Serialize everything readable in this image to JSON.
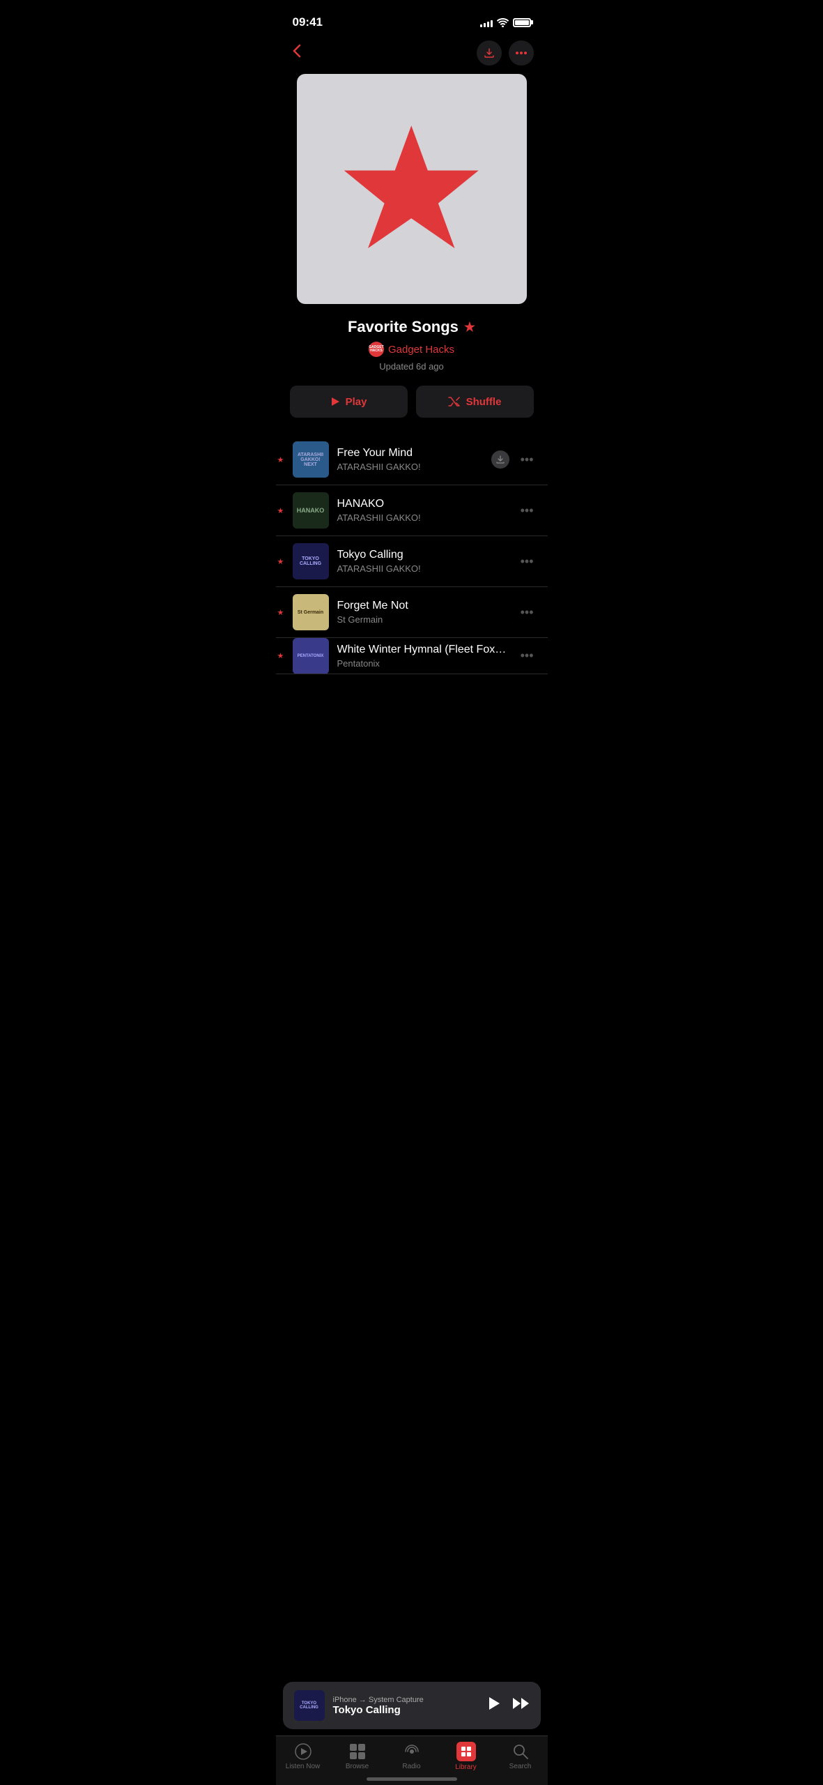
{
  "status": {
    "time": "09:41",
    "signal_bars": [
      4,
      6,
      8,
      10,
      12
    ],
    "battery_level": "100%"
  },
  "nav": {
    "back_label": "‹",
    "download_icon": "download",
    "more_icon": "more"
  },
  "playlist": {
    "title": "Favorite Songs",
    "title_star": "★",
    "author_badge": "GADGET HACKS",
    "author_name": "Gadget Hacks",
    "updated": "Updated 6d ago"
  },
  "buttons": {
    "play": "Play",
    "shuffle": "Shuffle"
  },
  "songs": [
    {
      "title": "Free Your Mind",
      "artist": "ATARASHII GAKKO!",
      "has_star": true,
      "has_download": true,
      "thumb_class": "thumb-1",
      "thumb_text": "ATARASHII GAKKO! NEXT"
    },
    {
      "title": "HANAKO",
      "artist": "ATARASHII GAKKO!",
      "has_star": true,
      "has_download": false,
      "thumb_class": "thumb-2",
      "thumb_text": "HANAKO"
    },
    {
      "title": "Tokyo Calling",
      "artist": "ATARASHII GAKKO!",
      "has_star": true,
      "has_download": false,
      "thumb_class": "thumb-3",
      "thumb_text": "TOKYO CALLING"
    },
    {
      "title": "Forget Me Not",
      "artist": "St Germain",
      "has_star": true,
      "has_download": false,
      "thumb_class": "thumb-4",
      "thumb_text": "St Germain"
    },
    {
      "title": "White Winter Hymnal (Fleet Foxes Cover)",
      "artist": "Pentatonix",
      "has_star": true,
      "has_download": false,
      "thumb_class": "thumb-5",
      "thumb_text": "PENTATONIX"
    }
  ],
  "now_playing": {
    "subtitle": "iPhone → System Capture",
    "title": "Tokyo Calling",
    "thumb_class": "thumb-3"
  },
  "tabs": [
    {
      "label": "Listen Now",
      "icon": "▶",
      "active": false,
      "name": "listen-now"
    },
    {
      "label": "Browse",
      "icon": "grid",
      "active": false,
      "name": "browse"
    },
    {
      "label": "Radio",
      "icon": "radio",
      "active": false,
      "name": "radio"
    },
    {
      "label": "Library",
      "icon": "library",
      "active": true,
      "name": "library"
    },
    {
      "label": "Search",
      "icon": "search",
      "active": false,
      "name": "search"
    }
  ],
  "colors": {
    "accent": "#e0373a",
    "background": "#000000",
    "card": "#1c1c1e",
    "text_primary": "#ffffff",
    "text_secondary": "#888888"
  }
}
